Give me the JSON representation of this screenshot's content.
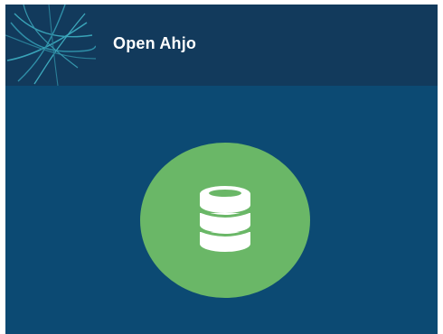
{
  "header": {
    "title": "Open Ahjo",
    "logo_icon": "thread-lines-logo-icon"
  },
  "main": {
    "badge_icon": "database-icon",
    "badge_color": "#6ab767"
  },
  "colors": {
    "header_bg": "#123a5c",
    "body_bg": "#0c4a73",
    "accent_lines": "#39a3b8",
    "icon_fill": "#ffffff"
  }
}
